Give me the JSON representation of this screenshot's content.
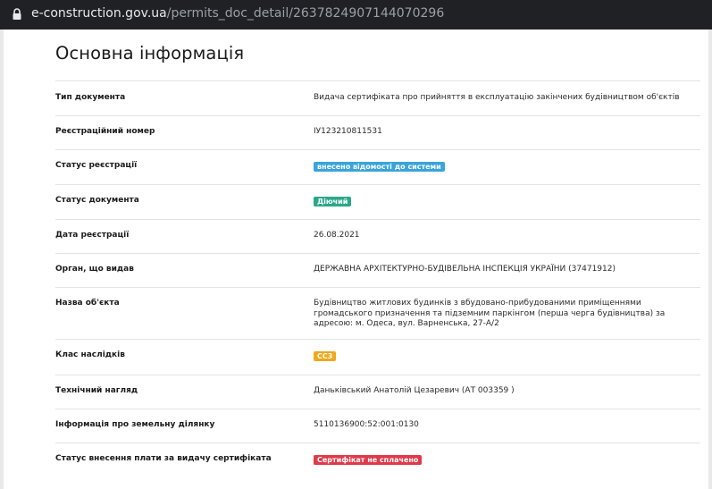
{
  "browser": {
    "url_domain": "e-construction.gov.ua",
    "url_path": "/permits_doc_detail/2637824907144070296"
  },
  "page": {
    "title": "Основна інформація"
  },
  "rows": [
    {
      "label": "Тип документа",
      "value": "Видача сертифіката про прийняття в експлуатацію закінчених будівництвом об'єктів"
    },
    {
      "label": "Реєстраційний номер",
      "value": "ІУ123210811531"
    },
    {
      "label": "Статус реєстрації",
      "badge": "внесено відомості до системи",
      "badge_color": "#3aa4dc"
    },
    {
      "label": "Статус документа",
      "badge": "Діючий",
      "badge_color": "#2aa88a"
    },
    {
      "label": "Дата реєстрації",
      "value": "26.08.2021"
    },
    {
      "label": "Орган, що видав",
      "value": "ДЕРЖАВНА АРХІТЕКТУРНО-БУДІВЕЛЬНА ІНСПЕКЦІЯ УКРАЇНИ (37471912)"
    },
    {
      "label": "Назва об'єкта",
      "value": "Будівництво житлових будинків з вбудовано-прибудованими приміщеннями громадського призначення та підземним паркінгом (перша черга будівництва) за адресою: м. Одеса, вул. Варненська, 27-А/2"
    },
    {
      "label": "Клас наслідків",
      "badge": "СС3",
      "badge_color": "#f0a81c"
    },
    {
      "label": "Технічний нагляд",
      "value": "Даньківський Анатолій Цезаревич (АТ 003359 )"
    },
    {
      "label": "Інформація про земельну ділянку",
      "value": "5110136900:52:001:0130"
    },
    {
      "label": "Статус внесення плати за видачу сертифіката",
      "badge": "Сертифікат не сплачено",
      "badge_color": "#e0394a"
    }
  ]
}
